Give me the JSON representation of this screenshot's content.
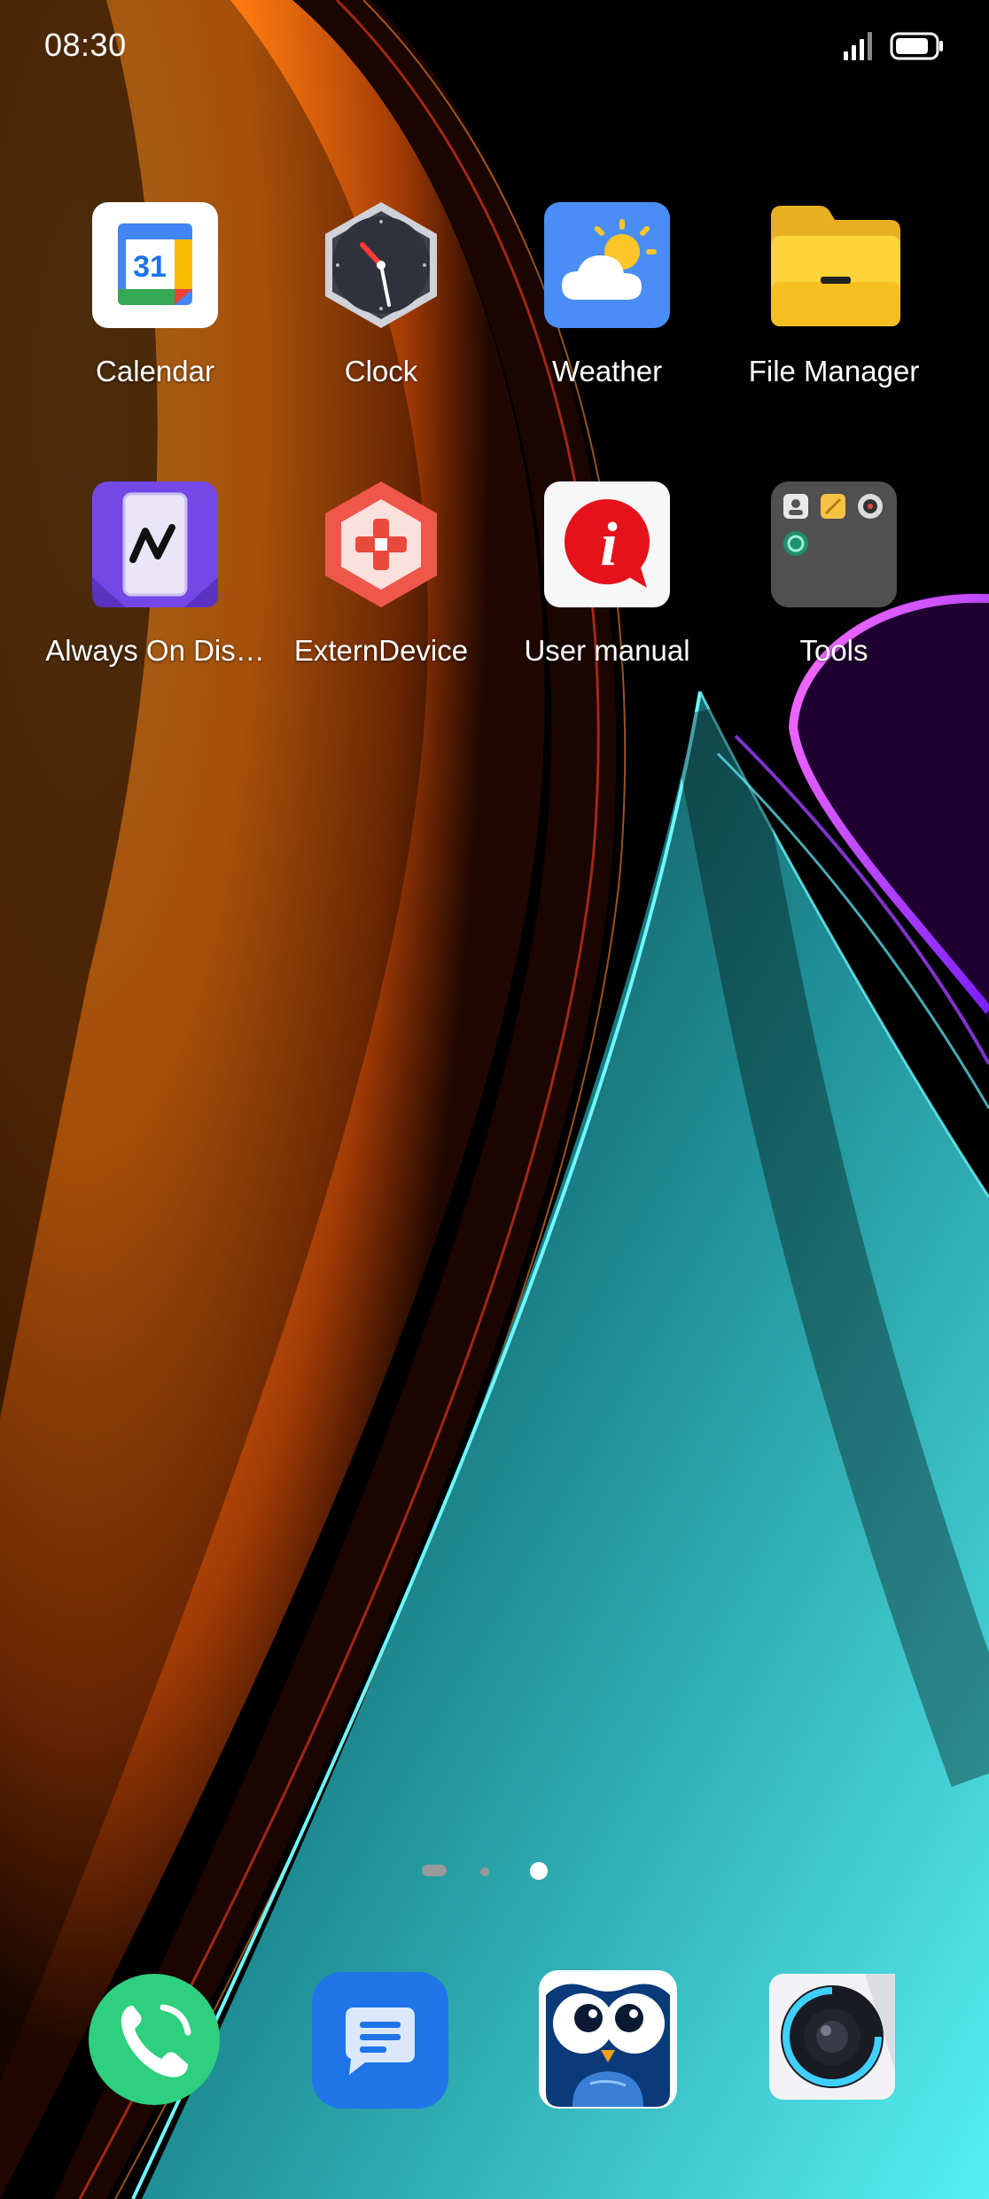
{
  "status_bar": {
    "time": "08:30",
    "signal_icon": "cellular-signal-icon",
    "battery_icon": "battery-icon"
  },
  "home_grid": {
    "rows": [
      [
        {
          "label": "Calendar",
          "icon": "calendar-icon",
          "icon_text": "31"
        },
        {
          "label": "Clock",
          "icon": "clock-icon"
        },
        {
          "label": "Weather",
          "icon": "weather-icon"
        },
        {
          "label": "File Manager",
          "icon": "folder-icon"
        }
      ],
      [
        {
          "label": "Always On Dis…",
          "icon": "always-on-display-icon"
        },
        {
          "label": "ExternDevice",
          "icon": "extern-device-icon"
        },
        {
          "label": "User manual",
          "icon": "user-manual-icon"
        },
        {
          "label": "Tools",
          "icon": "tools-folder-icon"
        }
      ]
    ]
  },
  "page_indicator": {
    "count": 3,
    "active_index": 2
  },
  "dock": {
    "apps": [
      {
        "icon": "phone-icon"
      },
      {
        "icon": "messages-icon"
      },
      {
        "icon": "owl-browser-icon"
      },
      {
        "icon": "camera-icon"
      }
    ]
  },
  "colors": {
    "wallpaper_orange": "#ff8a1a",
    "wallpaper_cyan": "#3ee6f0",
    "wallpaper_purple": "#d238ff",
    "phone_green": "#2ecf7f",
    "messages_blue": "#1f74e8",
    "weather_blue": "#4a8ef5",
    "folder_yellow": "#fcd43a",
    "aod_purple": "#7448e6",
    "extern_red": "#f0574b",
    "manual_red": "#e5121c"
  }
}
